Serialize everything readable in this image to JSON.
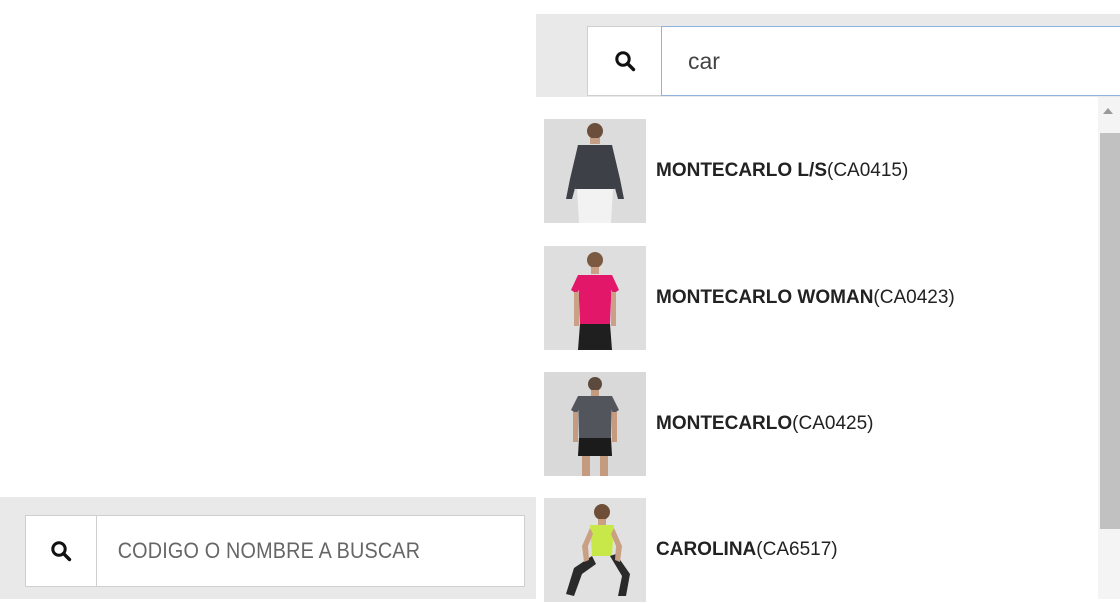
{
  "left_search": {
    "placeholder": "CODIGO O NOMBRE A BUSCAR",
    "icon": "search-icon"
  },
  "top_search": {
    "value": "car",
    "icon": "search-icon"
  },
  "results": [
    {
      "name": "MONTECARLO L/S",
      "code": "(CA0415)",
      "image": "man-longsleeve-dark-shirt"
    },
    {
      "name": "MONTECARLO WOMAN",
      "code": "(CA0423)",
      "image": "woman-pink-tshirt"
    },
    {
      "name": "MONTECARLO",
      "code": "(CA0425)",
      "image": "man-grey-tshirt"
    },
    {
      "name": "CAROLINA",
      "code": "(CA6517)",
      "image": "woman-lime-tanktop-sitting"
    }
  ],
  "colors": {
    "bar_bg": "#e9e9e9",
    "focus_border": "#8fb3dc",
    "scroll_thumb": "#c1c1c1"
  }
}
